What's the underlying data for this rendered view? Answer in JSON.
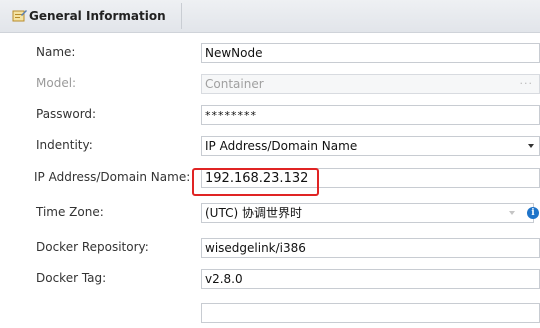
{
  "header": {
    "title": "General Information",
    "icon": "edit-form-icon"
  },
  "fields": [
    {
      "label": "Name:",
      "value": "NewNode"
    },
    {
      "label": "Model:",
      "value": "Container",
      "extra": "···"
    },
    {
      "label": "Password:",
      "value": "********"
    },
    {
      "label": "Indentity:",
      "value": "IP Address/Domain Name"
    },
    {
      "label": "IP Address/Domain Name:",
      "value": "192.168.23.132"
    },
    {
      "label": "Time Zone:",
      "value": "(UTC) 协调世界时",
      "info": "i"
    },
    {
      "label": "Docker Repository:",
      "value": "wisedgelink/i386"
    },
    {
      "label": "Docker Tag:",
      "value": "v2.8.0"
    },
    {
      "label": "",
      "value": ""
    }
  ],
  "colors": {
    "highlight": "#e02424",
    "info": "#1f74c9"
  }
}
